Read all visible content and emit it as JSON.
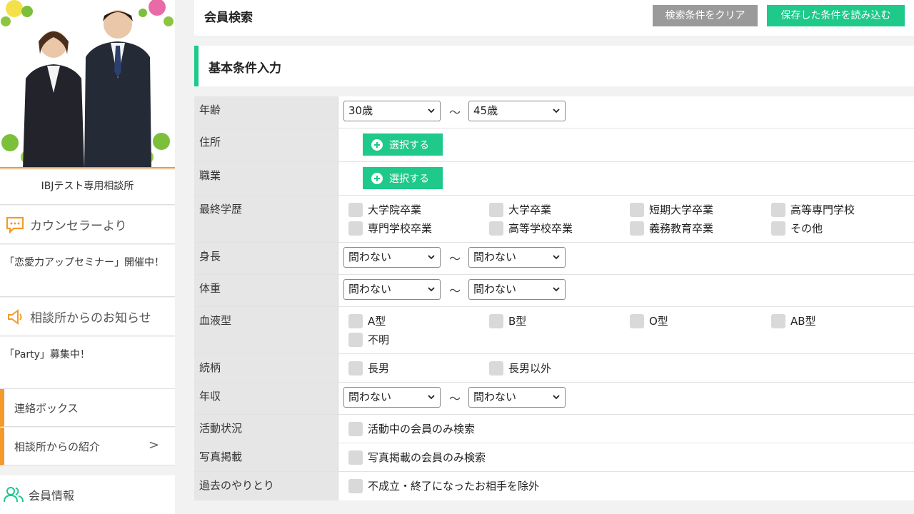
{
  "sidebar": {
    "office_name": "IBJテスト専用相談所",
    "counselor_head": "カウンセラーより",
    "counselor_text": "「恋愛力アップセミナー」開催中！",
    "notice_head": "相談所からのお知らせ",
    "notice_text": "「Party」募集中！",
    "nav_contact": "連絡ボックス",
    "nav_intro": "相談所からの紹介",
    "nav_intro_chevron": ">",
    "member_info": "会員情報"
  },
  "header": {
    "title": "会員検索",
    "clear_button": "検索条件をクリア",
    "load_button": "保存した条件を読み込む"
  },
  "section": {
    "title": "基本条件入力"
  },
  "form": {
    "tilde": "〜",
    "age": {
      "label": "年齢",
      "from": "30歳",
      "to": "45歳"
    },
    "address": {
      "label": "住所",
      "button": "選択する"
    },
    "occupation": {
      "label": "職業",
      "button": "選択する"
    },
    "education": {
      "label": "最終学歴",
      "options": [
        "大学院卒業",
        "大学卒業",
        "短期大学卒業",
        "高等専門学校",
        "専門学校卒業",
        "高等学校卒業",
        "義務教育卒業",
        "その他"
      ]
    },
    "height": {
      "label": "身長",
      "from": "問わない",
      "to": "問わない"
    },
    "weight": {
      "label": "体重",
      "from": "問わない",
      "to": "問わない"
    },
    "blood": {
      "label": "血液型",
      "options": [
        "A型",
        "B型",
        "O型",
        "AB型",
        "不明"
      ]
    },
    "sibling": {
      "label": "続柄",
      "options": [
        "長男",
        "長男以外"
      ]
    },
    "income": {
      "label": "年収",
      "from": "問わない",
      "to": "問わない"
    },
    "activity": {
      "label": "活動状況",
      "option": "活動中の会員のみ検索"
    },
    "photo": {
      "label": "写真掲載",
      "option": "写真掲載の会員のみ検索"
    },
    "history": {
      "label": "過去のやりとり",
      "option": "不成立・終了になったお相手を除外"
    }
  },
  "colors": {
    "accent_green": "#1ec98a",
    "accent_orange": "#f39a2a",
    "gray_button": "#9a9a9a"
  }
}
